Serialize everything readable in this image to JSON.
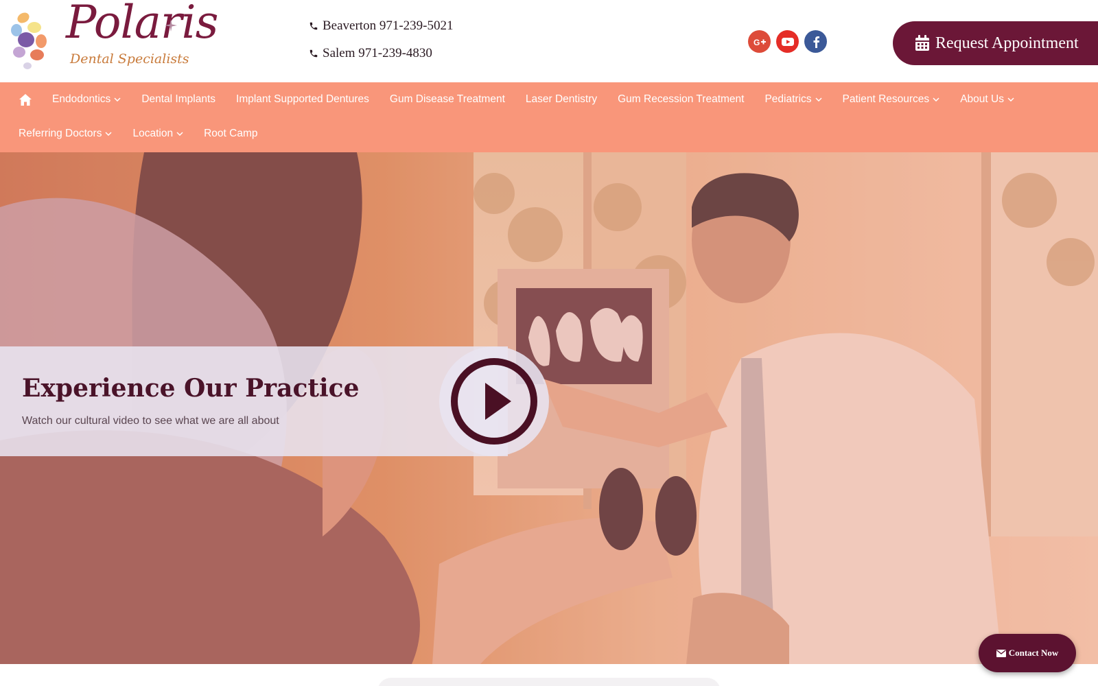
{
  "brand": {
    "name": "Polaris",
    "tagline": "Dental Specialists"
  },
  "contact": {
    "phones": [
      {
        "label": "Beaverton 971-239-5021"
      },
      {
        "label": "Salem 971-239-4830"
      }
    ]
  },
  "social": {
    "icons": [
      "google-plus-icon",
      "youtube-icon",
      "facebook-icon"
    ],
    "colors": {
      "google": "#dd4b39",
      "youtube": "#e52d27",
      "facebook": "#3b5998"
    }
  },
  "header": {
    "cta_label": "Request Appointment"
  },
  "nav": {
    "row1": [
      {
        "label": "Endodontics",
        "has_dropdown": true
      },
      {
        "label": "Dental Implants",
        "has_dropdown": false
      },
      {
        "label": "Implant Supported Dentures",
        "has_dropdown": false
      },
      {
        "label": "Gum Disease Treatment",
        "has_dropdown": false
      },
      {
        "label": "Laser Dentistry",
        "has_dropdown": false
      },
      {
        "label": "Gum Recession Treatment",
        "has_dropdown": false
      },
      {
        "label": "Pediatrics",
        "has_dropdown": true
      },
      {
        "label": "Patient Resources",
        "has_dropdown": true
      },
      {
        "label": "About Us",
        "has_dropdown": true
      }
    ],
    "row2": [
      {
        "label": "Referring Doctors",
        "has_dropdown": true
      },
      {
        "label": "Location",
        "has_dropdown": true
      },
      {
        "label": "Root Camp",
        "has_dropdown": false
      }
    ]
  },
  "hero": {
    "title": "Experience Our Practice",
    "subtitle": "Watch our cultural video to see what we are all about"
  },
  "floating": {
    "contact_label": "Contact Now"
  },
  "colors": {
    "brand": "#6b1737",
    "nav": "#f9967a",
    "accent": "#c87a3a"
  }
}
